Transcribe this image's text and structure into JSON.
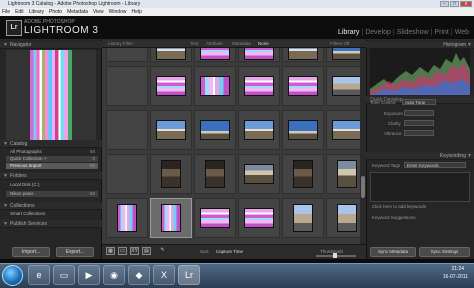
{
  "window": {
    "title": "Lightroom 3 Catalog - Adobe Photoshop Lightroom - Library",
    "buttons": [
      "–",
      "□",
      "x"
    ]
  },
  "menu": [
    "File",
    "Edit",
    "Library",
    "Photo",
    "Metadata",
    "View",
    "Window",
    "Help"
  ],
  "identity": {
    "logo": "Lr",
    "adobe": "ADOBE PHOTOSHOP",
    "product": "LIGHTROOM 3"
  },
  "modules": [
    "Library",
    "Develop",
    "Slideshow",
    "Print",
    "Web"
  ],
  "left": {
    "navigator": "Navigator",
    "catalog": "Catalog",
    "catalog_items": [
      {
        "label": "All Photographs",
        "count": "50"
      },
      {
        "label": "Quick Collection +",
        "count": "0"
      },
      {
        "label": "Previous Import",
        "count": "50"
      }
    ],
    "folders": "Folders",
    "folder_items": [
      {
        "label": "Local Disk (C:)",
        "count": ""
      },
      {
        "label": "Nikon panis",
        "count": "50"
      }
    ],
    "collections": "Collections",
    "collection_items": [
      {
        "label": "Smart Collections",
        "count": ""
      }
    ],
    "publish": "Publish Services",
    "import": "Import...",
    "export": "Export..."
  },
  "filter": {
    "label": "Library Filter :",
    "options": [
      "Text",
      "Attribute",
      "Metadata",
      "None"
    ],
    "preset": "Filters Off"
  },
  "toolbar": {
    "sort_label": "Sort:",
    "sort_value": "Capture Time",
    "thumbs_label": "Thumbnails"
  },
  "right": {
    "histogram": "Histogram",
    "quick_develop": "Quick Develop",
    "tone_control": "Tone Control",
    "auto_tone": "Auto Tone",
    "exposure": "Exposure",
    "clarity": "Clarity",
    "vibrance": "Vibrance",
    "keywording": "Keywording",
    "keyword_tags": "Keyword Tags",
    "keyword_mode": "Enter Keywords",
    "click_to_add": "Click here to add keywords",
    "suggestions": "Keyword Suggestions",
    "sync_metadata": "Sync Metadata",
    "sync_settings": "Sync Settings"
  },
  "taskbar": {
    "time": "21:24",
    "date": "16-07-2011"
  }
}
